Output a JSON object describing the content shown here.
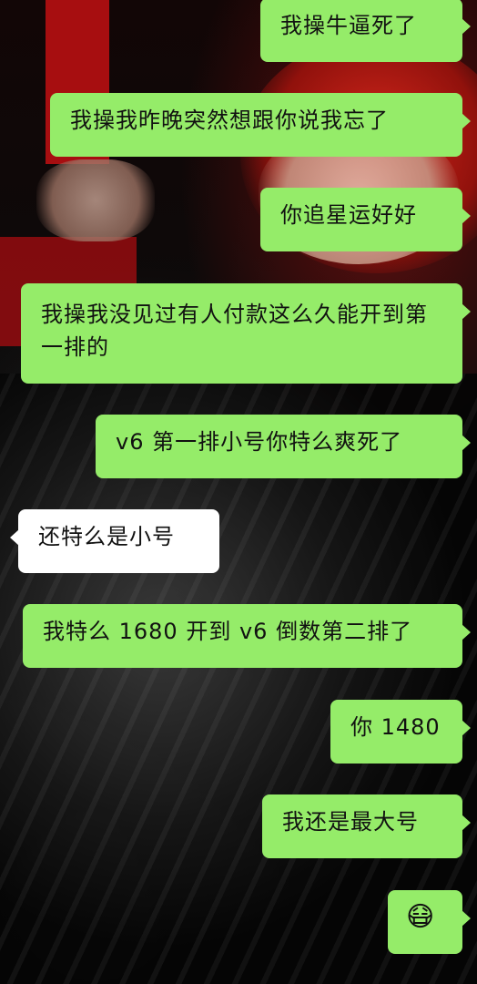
{
  "messages": [
    {
      "side": "out",
      "text": "我操牛逼死了"
    },
    {
      "side": "out",
      "text": "我操我昨晚突然想跟你说我忘了"
    },
    {
      "side": "out",
      "text": "你追星运好好"
    },
    {
      "side": "out",
      "text": "我操我没见过有人付款这么久能开到第一排的"
    },
    {
      "side": "out",
      "text": "v6 第一排小号你特么爽死了"
    },
    {
      "side": "in",
      "text": "还特么是小号"
    },
    {
      "side": "out",
      "text": "我特么 1680 开到 v6 倒数第二排了"
    },
    {
      "side": "out",
      "text": "你 1480"
    },
    {
      "side": "out",
      "text": "我还是最大号"
    },
    {
      "side": "out",
      "text": "😷",
      "icon": "mask-face-emoji"
    }
  ],
  "colors": {
    "outgoing_bubble": "#95ec69",
    "incoming_bubble": "#ffffff"
  }
}
